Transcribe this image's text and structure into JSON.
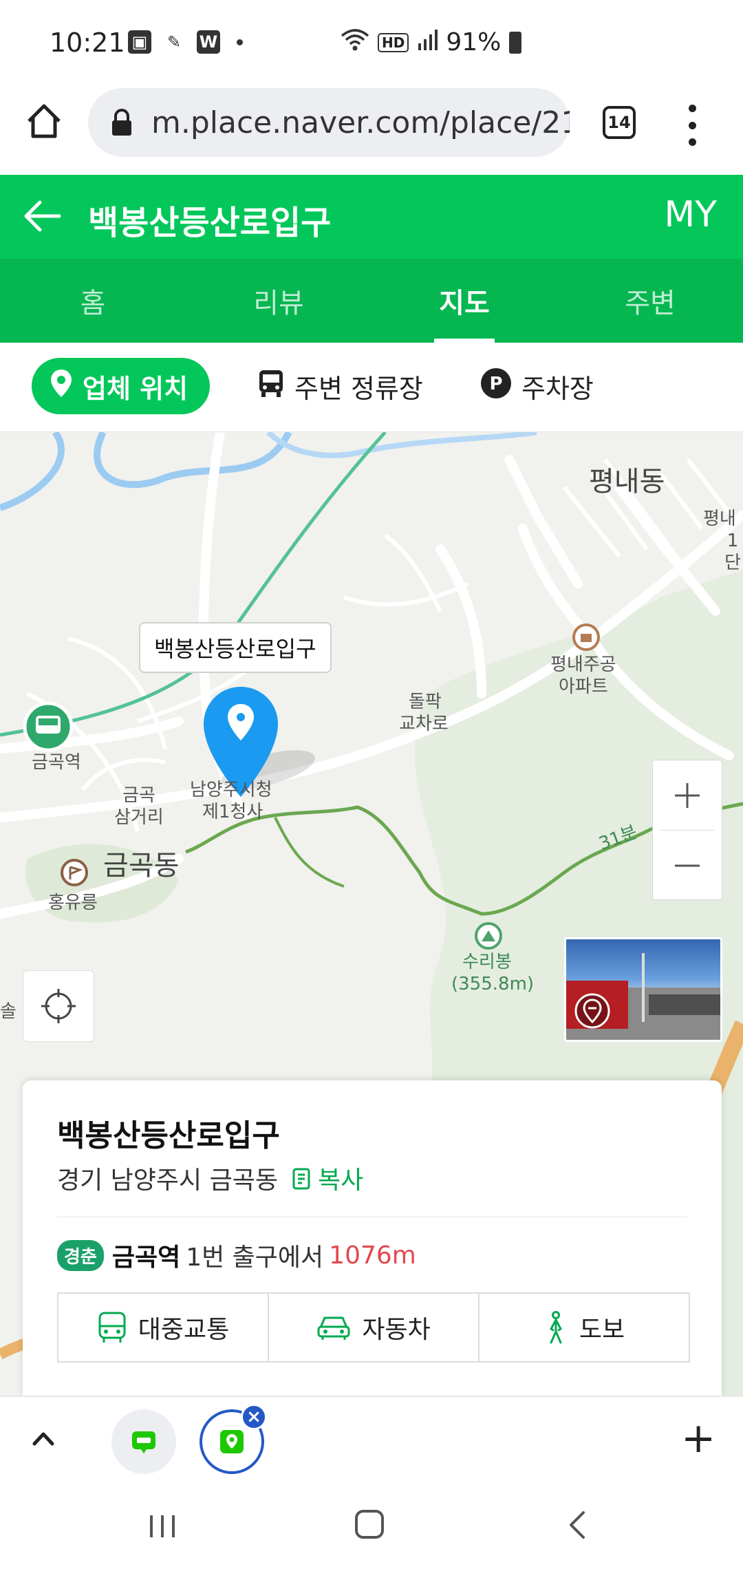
{
  "status_bar": {
    "time": "10:21",
    "battery": "91%"
  },
  "browser": {
    "url": "m.place.naver.com/place/21",
    "tab_count": "14"
  },
  "header": {
    "title": "백봉산등산로입구",
    "my_label": "MY"
  },
  "tabs": [
    {
      "label": "홈",
      "active": false
    },
    {
      "label": "리뷰",
      "active": false
    },
    {
      "label": "지도",
      "active": true
    },
    {
      "label": "주변",
      "active": false
    }
  ],
  "chips": {
    "location": "업체 위치",
    "stops": "주변 정류장",
    "parking": "주차장"
  },
  "map": {
    "pin_label": "백봉산등산로입구",
    "labels": {
      "pyeongnae_dong": "평내동",
      "pyeongnae_1": "평내",
      "pyeongnae_1b": "1단",
      "pyeongnae_apt_1": "평내주공",
      "pyeongnae_apt_2": "아파트",
      "dolpak_1": "돌팍",
      "dolpak_2": "교차로",
      "geumgok_station": "금곡역",
      "geumgok_sam_1": "금곡",
      "geumgok_sam_2": "삼거리",
      "cityhall_1": "남양주시청",
      "cityhall_2": "제1청사",
      "geumgok_dong": "금곡동",
      "hongyureung": "홍유릉",
      "suribong": "수리봉",
      "suribong_height": "(355.8m)",
      "trail_time": "31분",
      "left_edge": "솔"
    },
    "colors": {
      "pin": "#1a9af0",
      "trail": "#6aa84f",
      "railway": "#53c295",
      "river": "#9ccbf2",
      "highway": "#e9b36b"
    }
  },
  "card": {
    "title": "백봉산등산로입구",
    "address": "경기 남양주시 금곡동",
    "copy_label": "복사",
    "line_badge": "경춘",
    "station": "금곡역",
    "exit_text": "1번 출구에서",
    "distance": "1076m",
    "route_buttons": {
      "transit": "대중교통",
      "car": "자동차",
      "walk": "도보"
    }
  },
  "colors": {
    "brand_green": "#03c75a",
    "tab_green": "#05b651",
    "distance_red": "#e0484e",
    "tab_ring_blue": "#2458c6"
  }
}
